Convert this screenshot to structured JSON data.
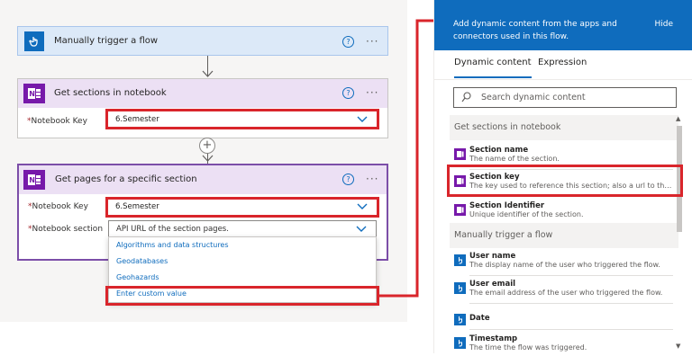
{
  "flow": {
    "trigger": {
      "title": "Manually trigger a flow",
      "icon": "hand-tap-icon",
      "color": "#0f6cbd"
    },
    "step1": {
      "title": "Get sections in notebook",
      "icon": "onenote-icon",
      "field_label": "Notebook Key",
      "field_value": "6.Semester"
    },
    "step2": {
      "title": "Get pages for a specific section",
      "icon": "onenote-icon",
      "notebook_label": "Notebook Key",
      "notebook_value": "6.Semester",
      "section_label": "Notebook section",
      "section_value": "API URL of the section pages.",
      "dropdown_options": [
        "Algorithms and data structures",
        "Geodatabases",
        "Geohazards",
        "Enter custom value"
      ]
    },
    "required_mark": "*",
    "help_glyph": "?",
    "more_glyph": "···",
    "add_glyph": "+"
  },
  "panel": {
    "header": "Add dynamic content from the apps and connectors used in this flow.",
    "hide": "Hide",
    "tabs": [
      "Dynamic content",
      "Expression"
    ],
    "search_placeholder": "Search dynamic content",
    "sections": [
      {
        "title": "Get sections in notebook",
        "items": [
          {
            "name": "Section name",
            "desc": "The name of the section.",
            "icon": "onenote-icon"
          },
          {
            "name": "Section key",
            "desc": "The key used to reference this section; also a url to the pa...",
            "icon": "onenote-icon"
          },
          {
            "name": "Section Identifier",
            "desc": "Unique identifier of the section.",
            "icon": "onenote-icon"
          }
        ]
      },
      {
        "title": "Manually trigger a flow",
        "items": [
          {
            "name": "User name",
            "desc": "The display name of the user who triggered the flow.",
            "icon": "hand-tap-icon"
          },
          {
            "name": "User email",
            "desc": "The email address of the user who triggered the flow.",
            "icon": "hand-tap-icon"
          },
          {
            "name": "Date",
            "desc": "",
            "icon": "hand-tap-icon"
          },
          {
            "name": "Timestamp",
            "desc": "The time the flow was triggered.",
            "icon": "hand-tap-icon"
          }
        ]
      }
    ]
  },
  "colors": {
    "accent": "#0f6cbd",
    "onenote": "#7719aa",
    "highlight": "#d9252b",
    "card_selected": "#7c4ea8"
  }
}
